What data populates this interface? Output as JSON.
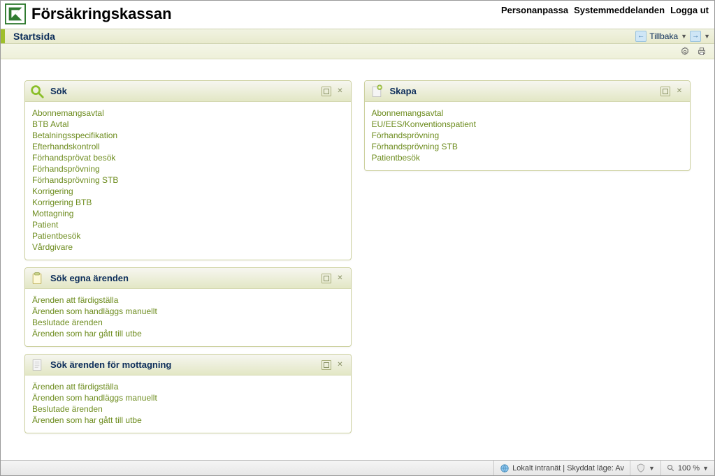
{
  "brand": {
    "name": "Försäkringskassan"
  },
  "topmenu": {
    "personalize": "Personanpassa",
    "sysmsg": "Systemmeddelanden",
    "logout": "Logga ut"
  },
  "titlebar": {
    "title": "Startsida",
    "back": "Tillbaka"
  },
  "panels": {
    "search": {
      "title": "Sök",
      "items": [
        "Abonnemangsavtal",
        "BTB Avtal",
        "Betalningsspecifikation",
        "Efterhandskontroll",
        "Förhandsprövat besök",
        "Förhandsprövning",
        "Förhandsprövning STB",
        "Korrigering",
        "Korrigering BTB",
        "Mottagning",
        "Patient",
        "Patientbesök",
        "Vårdgivare"
      ]
    },
    "own": {
      "title": "Sök egna ärenden",
      "items": [
        "Ärenden att färdigställa",
        "Ärenden som handläggs manuellt",
        "Beslutade ärenden",
        "Ärenden som har gått till utbe"
      ]
    },
    "reception": {
      "title": "Sök ärenden för mottagning",
      "items": [
        "Ärenden att färdigställa",
        "Ärenden som handläggs manuellt",
        "Beslutade ärenden",
        "Ärenden som har gått till utbe"
      ]
    },
    "create": {
      "title": "Skapa",
      "items": [
        "Abonnemangsavtal",
        "EU/EES/Konventionspatient",
        "Förhandsprövning",
        "Förhandsprövning STB",
        "Patientbesök"
      ]
    }
  },
  "statusbar": {
    "zone": "Lokalt intranät | Skyddat läge: Av",
    "zoom": "100 %"
  }
}
